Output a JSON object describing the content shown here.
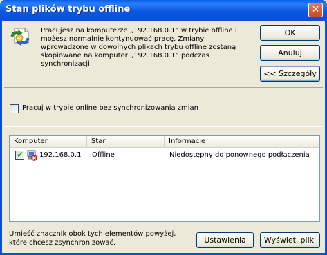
{
  "window": {
    "title": "Stan plików trybu offline",
    "close_glyph": "✕"
  },
  "message": {
    "text": "Pracujesz na komputerze „192.168.0.1” w trybie offline i możesz normalnie kontynuować pracę. Zmiany wprowadzone w dowolnych plikach trybu offline zostaną skopiowane na komputer „192.168.0.1” podczas synchronizacji.",
    "icon": "offline-files-sync-icon"
  },
  "buttons": {
    "ok": "OK",
    "cancel": "Anuluj",
    "details": "<< Szczegóły",
    "settings": "Ustawienia",
    "show_files": "Wyświetl pliki"
  },
  "online_option": {
    "label": "Pracuj w trybie online bez synchronizowania zmian",
    "checked": false
  },
  "list": {
    "columns": [
      "Komputer",
      "Stan",
      "Informacje"
    ],
    "rows": [
      {
        "checked": true,
        "icon": "network-computer-offline-icon",
        "computer": "192.168.0.1",
        "status": "Offline",
        "info": "Niedostępny do ponownego podłączenia"
      }
    ]
  },
  "hint": "Umieść znacznik obok tych elementów powyżej, które chcesz zsynchronizować.",
  "colors": {
    "titlebar": "#0a5fe8",
    "dialog_bg": "#ece9d8",
    "button_border": "#003c74",
    "checkmark": "#21a121"
  }
}
